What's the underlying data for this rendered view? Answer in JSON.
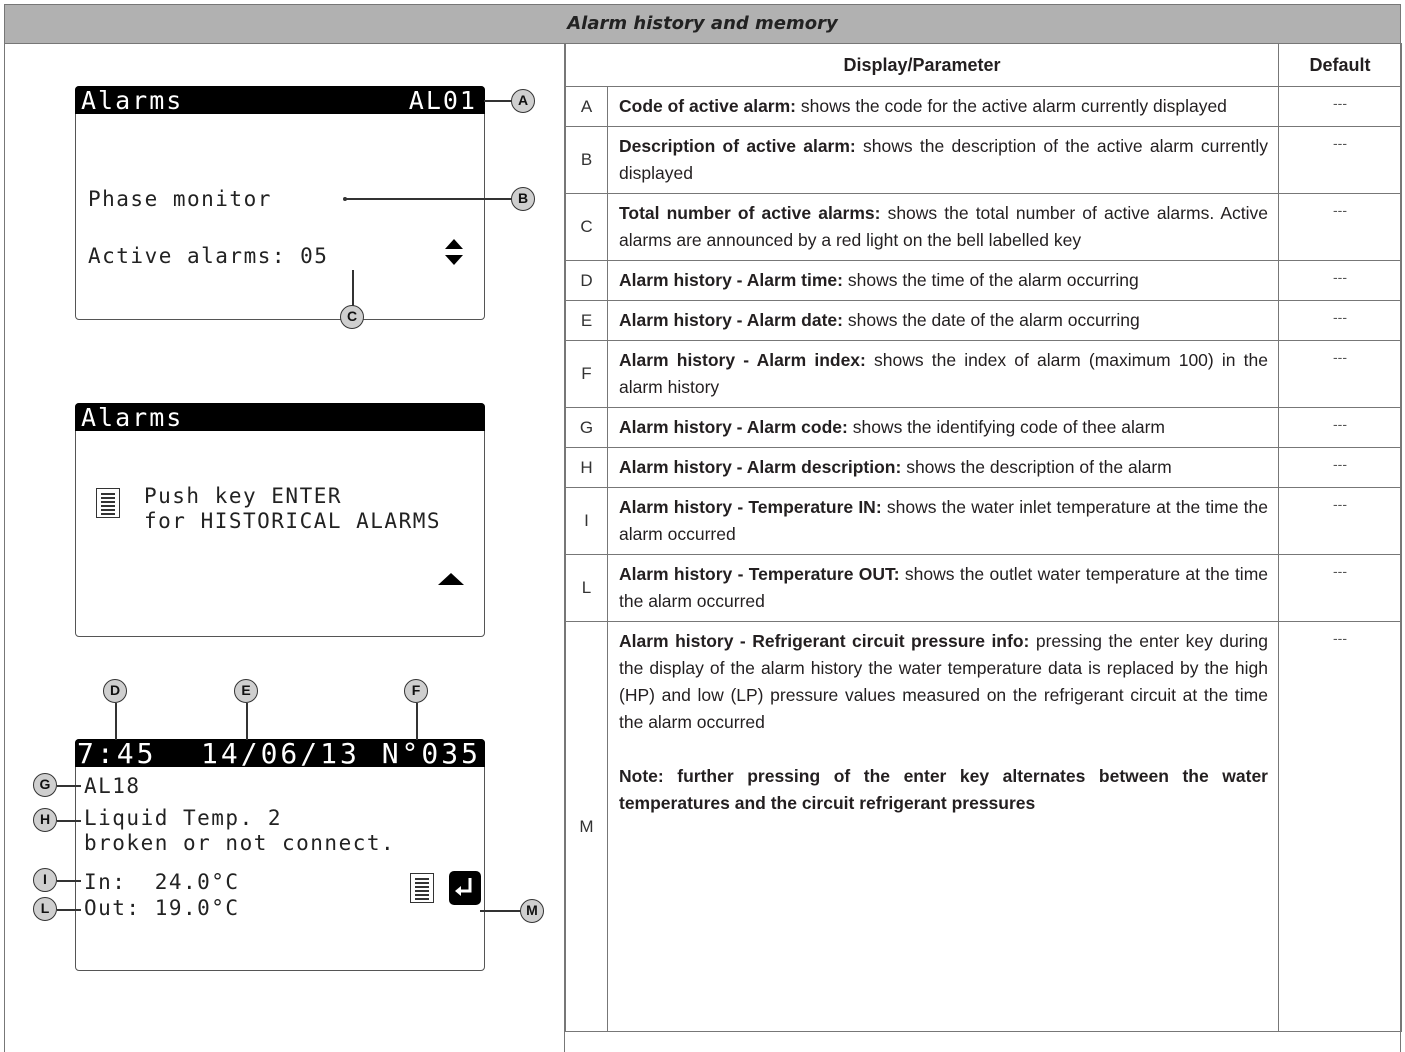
{
  "title": "Alarm history and memory",
  "table": {
    "col_param": "Display/Parameter",
    "col_default": "Default",
    "rows": [
      {
        "key": "A",
        "term": "Code of active alarm:",
        "text": " shows the code for the active alarm currently displayed",
        "default": "---"
      },
      {
        "key": "B",
        "term": "Description of active alarm:",
        "text": " shows the description of the  active alarm currently displayed",
        "default": "---"
      },
      {
        "key": "C",
        "term": "Total number of active alarms:",
        "text": " shows the total number  of active alarms. Active alarms are announced by a red light on the bell labelled key",
        "default": "---"
      },
      {
        "key": "D",
        "term": "Alarm history - Alarm time:",
        "text": " shows the time of the alarm occurring",
        "default": "---"
      },
      {
        "key": "E",
        "term": "Alarm history - Alarm date:",
        "text": " shows the date of the alarm occurring",
        "default": "---"
      },
      {
        "key": "F",
        "term": "Alarm history - Alarm index:",
        "text": " shows the index of alarm (maximum 100) in the alarm history",
        "default": "---"
      },
      {
        "key": "G",
        "term": "Alarm history - Alarm code:",
        "text": " shows the identifying code of thee alarm",
        "default": "---"
      },
      {
        "key": "H",
        "term": "Alarm history - Alarm description:",
        "text": " shows the description of the alarm",
        "default": "---"
      },
      {
        "key": "I",
        "term": "Alarm history - Temperature IN:",
        "text": " shows the water inlet temperature at the time the alarm occurred",
        "default": "---"
      },
      {
        "key": "L",
        "term": "Alarm history - Temperature OUT:",
        "text": " shows the outlet water temperature at the time the alarm occurred",
        "default": "---"
      },
      {
        "key": "M",
        "term": "Alarm history - Refrigerant circuit pressure info:",
        "text": " pressing the enter key during the display of the alarm history the water temperature data is replaced by the high (HP) and low (LP) pressure values measured on the refrigerant circuit at the time the alarm occurred",
        "note": "Note: further pressing of the enter key alternates between the water temperatures and the circuit refrigerant pressures",
        "default": "---"
      }
    ]
  },
  "lcd1": {
    "header_left": "Alarms",
    "header_right": "AL01",
    "description": "Phase monitor",
    "active_label": "Active alarms: 05"
  },
  "lcd2": {
    "header": "Alarms",
    "line1": "Push key ENTER",
    "line2": "for HISTORICAL ALARMS"
  },
  "lcd3": {
    "time": "7:45",
    "date": "14/06/13",
    "index": "N°035",
    "code": "AL18",
    "desc1": "Liquid Temp. 2",
    "desc2": "broken or not connect.",
    "temp_in": "In:  24.0°C",
    "temp_out": "Out: 19.0°C"
  },
  "callouts": [
    "A",
    "B",
    "C",
    "D",
    "E",
    "F",
    "G",
    "H",
    "I",
    "L",
    "M"
  ]
}
